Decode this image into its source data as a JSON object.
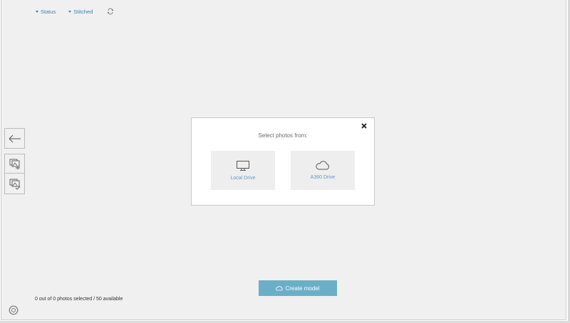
{
  "filters": {
    "status_label": "Status",
    "stitched_label": "Stitched"
  },
  "modal": {
    "title": "Select photos from:",
    "sources": [
      {
        "label": "Local Drive",
        "icon": "monitor-icon"
      },
      {
        "label": "A360 Drive",
        "icon": "cloud-icon"
      }
    ]
  },
  "actions": {
    "create_model_label": "Create model"
  },
  "footer": {
    "selection_status": "0 out of 0 photos selected / 50 available"
  },
  "colors": {
    "accent_blue": "#3c82b8",
    "create_button": "#6bafc7",
    "background": "#f0f0f0"
  }
}
